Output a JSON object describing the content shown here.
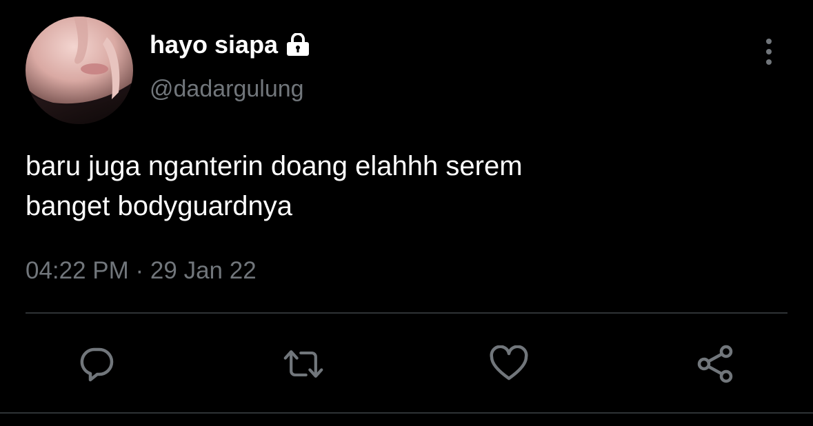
{
  "tweet": {
    "display_name": "hayo siapa",
    "handle": "@dadargulung",
    "text": "baru juga nganterin doang elahhh serem\nbanget bodyguardnya",
    "timestamp": "04:22 PM · 29 Jan 22",
    "protected_icon": "lock-icon"
  },
  "actions": [
    {
      "name": "reply",
      "icon": "reply-icon"
    },
    {
      "name": "retweet",
      "icon": "retweet-icon"
    },
    {
      "name": "like",
      "icon": "heart-icon"
    },
    {
      "name": "share",
      "icon": "share-icon"
    }
  ],
  "menu": {
    "icon": "more-vertical-icon"
  },
  "colors": {
    "background": "#000000",
    "primary_text": "#ffffff",
    "secondary_text": "#71767b",
    "divider": "#2f3336"
  }
}
